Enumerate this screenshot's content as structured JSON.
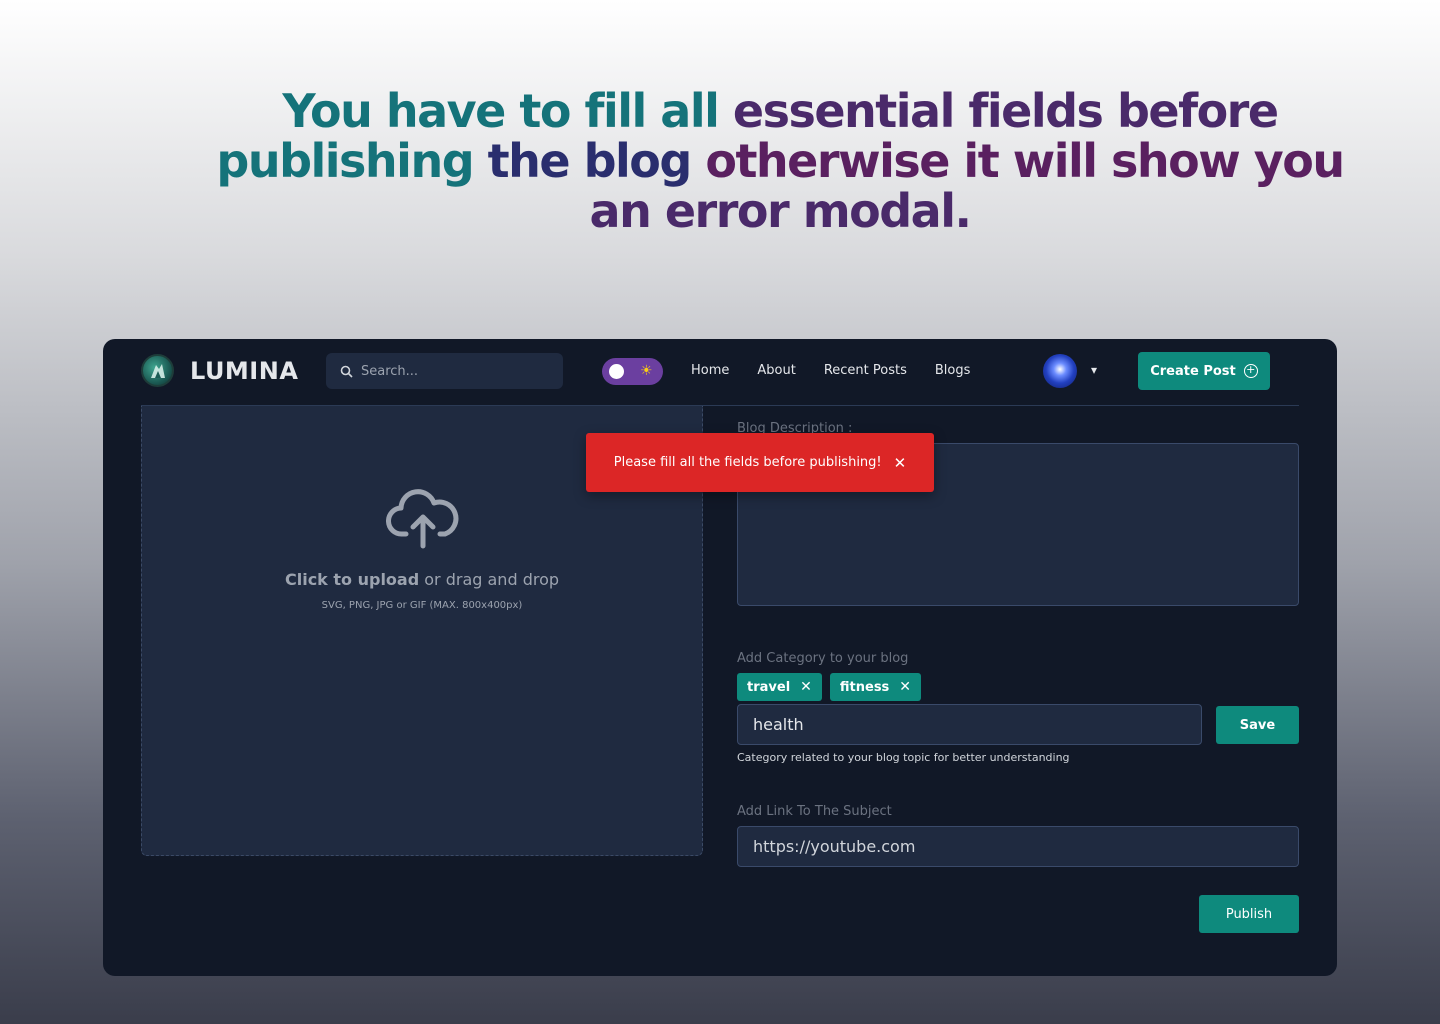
{
  "headline": {
    "w1": "You have to fill all",
    "w2": "essential fields before",
    "w3": "publishing",
    "w4": "the blog",
    "w5": "otherwise it will show you",
    "w6": "an error modal."
  },
  "nav": {
    "brand": "LUMINA",
    "search_placeholder": "Search...",
    "links": [
      "Home",
      "About",
      "Recent Posts",
      "Blogs"
    ],
    "create_label": "Create Post"
  },
  "upload": {
    "click_text": "Click to upload",
    "drag_text": "or drag and drop",
    "formats": "SVG, PNG, JPG or GIF (MAX. 800x400px)"
  },
  "form": {
    "description_label": "Blog Description :",
    "category_label": "Add Category to your blog",
    "tags": [
      "travel",
      "fitness"
    ],
    "category_value": "health",
    "save_label": "Save",
    "category_help": "Category related to your blog topic for better understanding",
    "link_label": "Add Link To The Subject",
    "link_value": "https://youtube.com",
    "publish_label": "Publish"
  },
  "toast": {
    "message": "Please fill all the fields before publishing!",
    "close": "✕"
  },
  "colors": {
    "accent": "#0e8a7d",
    "error": "#dc2626",
    "app_bg": "#111827",
    "panel": "#1f2a40"
  }
}
